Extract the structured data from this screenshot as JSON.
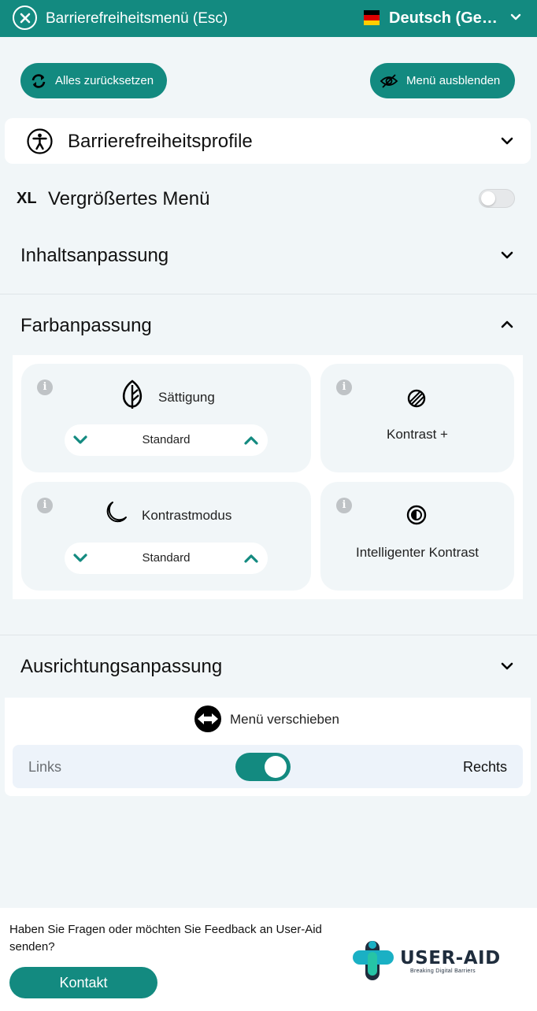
{
  "header": {
    "title": "Barrierefreiheitsmenü (Esc)",
    "language": "Deutsch (German)",
    "flag_colors": [
      "#000000",
      "#dd0000",
      "#ffce00"
    ]
  },
  "actions": {
    "reset_label": "Alles zurücksetzen",
    "hide_label": "Menü ausblenden"
  },
  "sections": {
    "profiles": "Barrierefreiheitsprofile",
    "xl_badge": "XL",
    "enlarged_menu": "Vergrößertes Menü",
    "enlarged_menu_on": false,
    "content": "Inhaltsanpassung",
    "color": "Farbanpassung",
    "alignment": "Ausrichtungsanpassung"
  },
  "color_tiles": {
    "saturation": {
      "label": "Sättigung",
      "value": "Standard"
    },
    "contrast_plus": {
      "label": "Kontrast +"
    },
    "contrast_mode": {
      "label": "Kontrastmodus",
      "value": "Standard"
    },
    "smart_contrast": {
      "label": "Intelligenter Kontrast"
    }
  },
  "move_menu": {
    "label": "Menü verschieben",
    "left": "Links",
    "right": "Rechts",
    "position": "Rechts"
  },
  "footer": {
    "question": "Haben Sie Fragen oder möchten Sie Feedback an User-Aid senden?",
    "contact_label": "Kontakt",
    "logo_name": "USER-AID",
    "logo_tagline": "Breaking Digital Barriers"
  },
  "colors": {
    "accent": "#138a80",
    "background": "#f1f6f8"
  }
}
